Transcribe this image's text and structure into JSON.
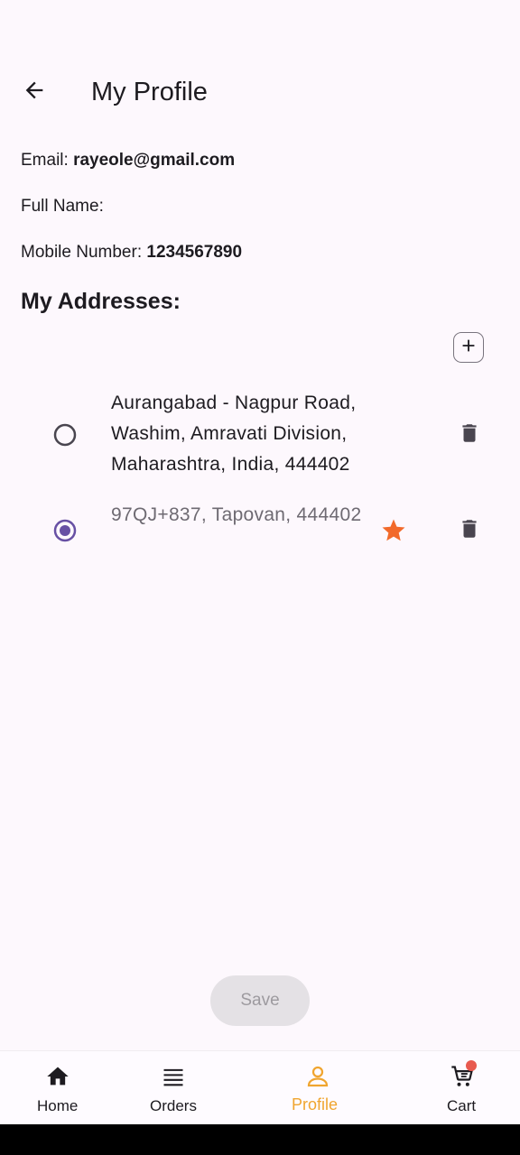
{
  "appbar": {
    "title": "My Profile",
    "back_icon": "arrow-left"
  },
  "profile": {
    "email_label": "Email:",
    "email_value": "rayeole@gmail.com",
    "fullname_label": "Full Name:",
    "fullname_value": "",
    "mobile_label": "Mobile Number:",
    "mobile_value": "1234567890"
  },
  "addresses": {
    "title": "My Addresses:",
    "add_icon": "plus",
    "items": [
      {
        "text": "Aurangabad - Nagpur Road, Washim, Amravati Division, Maharashtra, India, 444402",
        "selected": false,
        "default": false
      },
      {
        "text": "97QJ+837, Tapovan, 444402",
        "selected": true,
        "default": true
      }
    ]
  },
  "save_label": "Save",
  "nav": {
    "items": [
      {
        "label": "Home",
        "icon": "home",
        "active": false
      },
      {
        "label": "Orders",
        "icon": "list",
        "active": false
      },
      {
        "label": "Profile",
        "icon": "person",
        "active": true
      },
      {
        "label": "Cart",
        "icon": "cart",
        "active": false,
        "badge": true
      }
    ]
  },
  "colors": {
    "accent": "#f0a52f",
    "radio_selected": "#6750a4",
    "star": "#f26a2b",
    "background": "#fdf8fd"
  }
}
